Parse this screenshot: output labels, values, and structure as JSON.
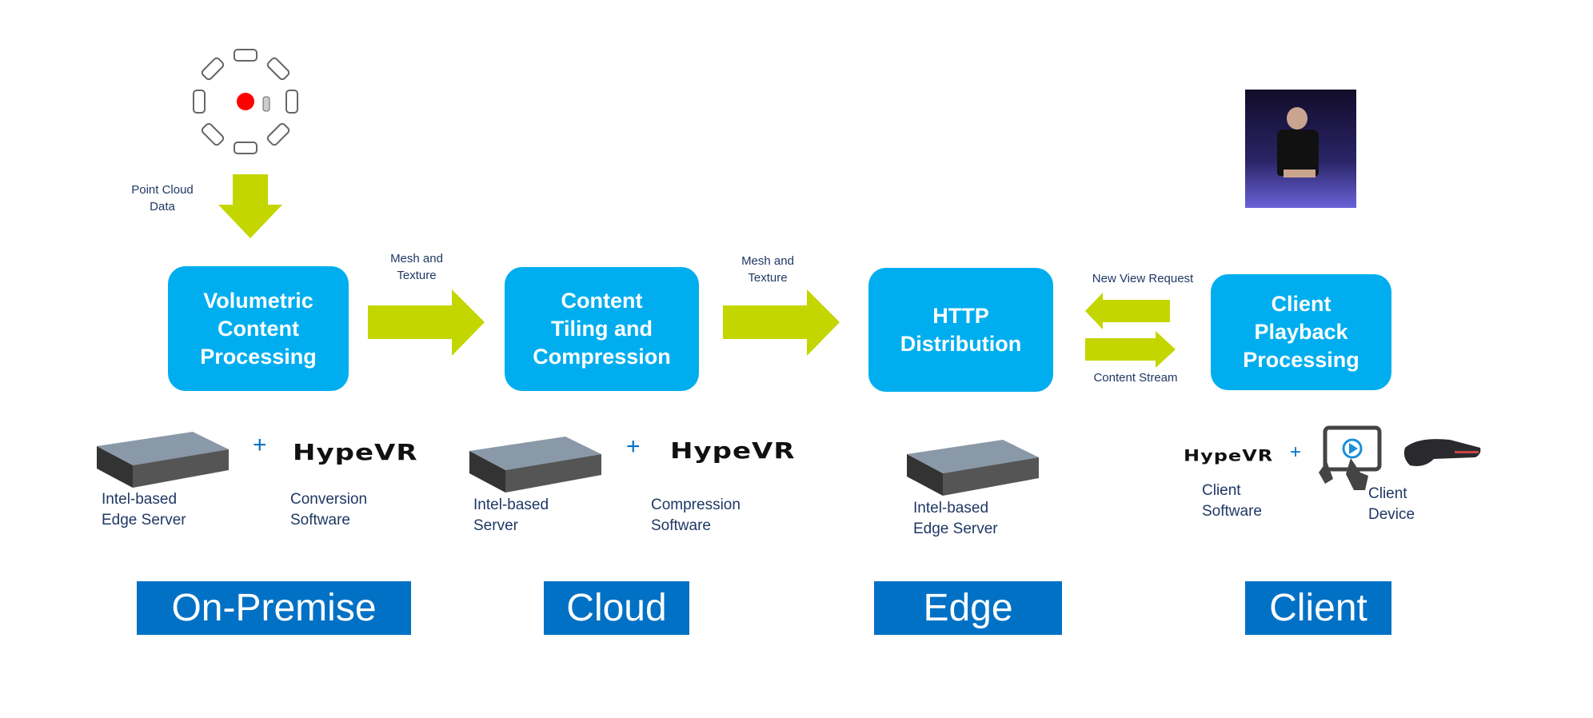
{
  "colors": {
    "process_box": "#00AEEF",
    "arrow": "#C4D600",
    "tier": "#0071C5",
    "text": "#1F3864"
  },
  "input": {
    "label": "Point Cloud\nData",
    "icon": "camera-rig-icon"
  },
  "flows": {
    "mesh1": "Mesh and\nTexture",
    "mesh2": "Mesh and\nTexture",
    "request": "New View Request",
    "stream": "Content Stream"
  },
  "boxes": [
    {
      "label": "Volumetric\nContent\nProcessing"
    },
    {
      "label": "Content\nTiling and\nCompression"
    },
    {
      "label": "HTTP\nDistribution"
    },
    {
      "label": "Client\nPlayback\nProcessing"
    }
  ],
  "components": {
    "brand": "HypeVR",
    "plus": "+",
    "onprem_server": "Intel-based\nEdge Server",
    "onprem_software": "Conversion\nSoftware",
    "cloud_server": "Intel-based\nServer",
    "cloud_software": "Compression\nSoftware",
    "edge_server": "Intel-based\nEdge Server",
    "client_software": "Client\nSoftware",
    "client_device": "Client\nDevice"
  },
  "tiers": [
    "On-Premise",
    "Cloud",
    "Edge",
    "Client"
  ]
}
